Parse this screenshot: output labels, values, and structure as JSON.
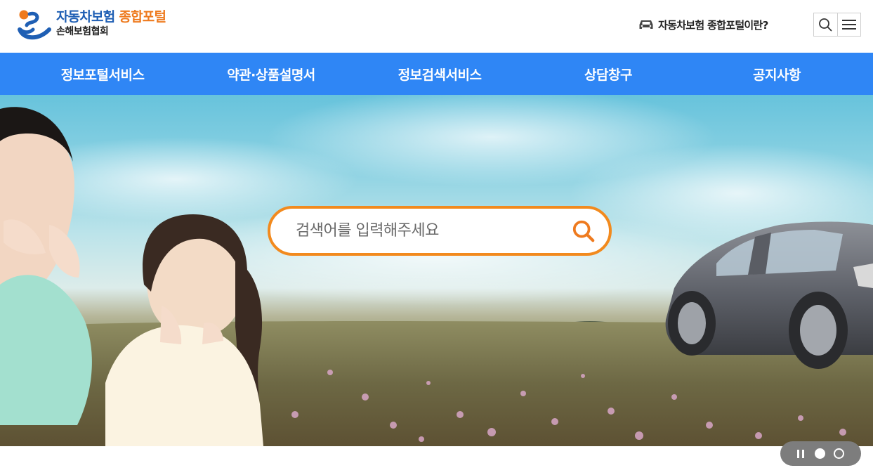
{
  "header": {
    "logo": {
      "title_main": "자동차보험",
      "title_accent": "종합포털",
      "subtitle": "손해보험협회"
    },
    "about_link": "자동차보험 종합포털이란?",
    "icons": {
      "about": "car-icon",
      "search": "search-icon",
      "menu": "hamburger-menu-icon"
    }
  },
  "gnb": {
    "items": [
      {
        "label": "정보포털서비스"
      },
      {
        "label": "약관·상품설명서"
      },
      {
        "label": "정보검색서비스"
      },
      {
        "label": "상담창구"
      },
      {
        "label": "공지사항"
      }
    ]
  },
  "hero": {
    "search": {
      "placeholder": "검색어를 입력해주세요",
      "value": ""
    }
  },
  "slider": {
    "slide_count": 2,
    "active_index": 0,
    "state": "playing"
  },
  "colors": {
    "nav_blue": "#2f86f5",
    "accent_orange": "#f28a1e",
    "logo_blue": "#1f5fb4",
    "logo_orange": "#ee7a1e"
  }
}
